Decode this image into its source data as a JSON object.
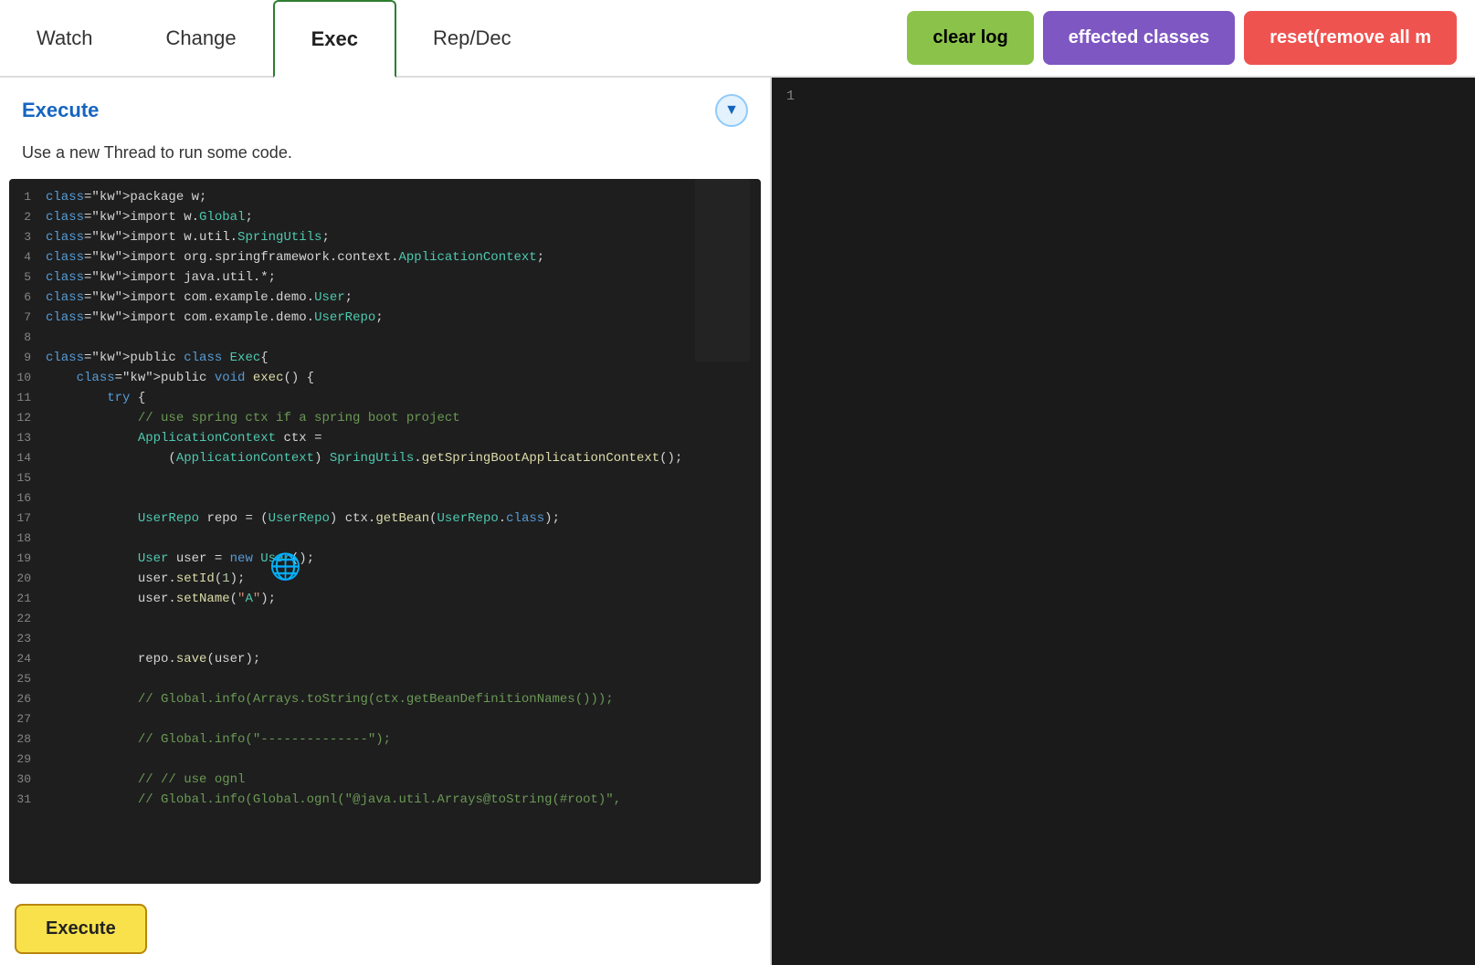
{
  "tabs": [
    {
      "id": "watch",
      "label": "Watch",
      "active": false
    },
    {
      "id": "change",
      "label": "Change",
      "active": false
    },
    {
      "id": "exec",
      "label": "Exec",
      "active": true
    },
    {
      "id": "rep-dec",
      "label": "Rep/Dec",
      "active": false
    }
  ],
  "buttons": {
    "clear_log": "clear log",
    "effected_classes": "effected classes",
    "reset": "reset(remove all m"
  },
  "execute_section": {
    "title": "Execute",
    "description": "Use a new Thread to run some code.",
    "dropdown_icon": "▼"
  },
  "execute_button": "Execute",
  "right_panel": {
    "line_number": "1"
  },
  "code": [
    {
      "n": 1,
      "raw": "package w;"
    },
    {
      "n": 2,
      "raw": "import w.Global;"
    },
    {
      "n": 3,
      "raw": "import w.util.SpringUtils;"
    },
    {
      "n": 4,
      "raw": "import org.springframework.context.ApplicationContext;"
    },
    {
      "n": 5,
      "raw": "import java.util.*;"
    },
    {
      "n": 6,
      "raw": "import com.example.demo.User;"
    },
    {
      "n": 7,
      "raw": "import com.example.demo.UserRepo;"
    },
    {
      "n": 8,
      "raw": ""
    },
    {
      "n": 9,
      "raw": "public class Exec{"
    },
    {
      "n": 10,
      "raw": "    public void exec() {"
    },
    {
      "n": 11,
      "raw": "        try {"
    },
    {
      "n": 12,
      "raw": "            // use spring ctx if a spring boot project"
    },
    {
      "n": 13,
      "raw": "            ApplicationContext ctx ="
    },
    {
      "n": 14,
      "raw": "                (ApplicationContext) SpringUtils.getSpringBootApplicationContext();"
    },
    {
      "n": 15,
      "raw": ""
    },
    {
      "n": 16,
      "raw": ""
    },
    {
      "n": 17,
      "raw": "            UserRepo repo = (UserRepo) ctx.getBean(UserRepo.class);"
    },
    {
      "n": 18,
      "raw": ""
    },
    {
      "n": 19,
      "raw": "            User user = new User();"
    },
    {
      "n": 20,
      "raw": "            user.setId(1);"
    },
    {
      "n": 21,
      "raw": "            user.setName(\"A\");"
    },
    {
      "n": 22,
      "raw": ""
    },
    {
      "n": 23,
      "raw": ""
    },
    {
      "n": 24,
      "raw": "            repo.save(user);"
    },
    {
      "n": 25,
      "raw": ""
    },
    {
      "n": 26,
      "raw": "            // Global.info(Arrays.toString(ctx.getBeanDefinitionNames()));"
    },
    {
      "n": 27,
      "raw": ""
    },
    {
      "n": 28,
      "raw": "            // Global.info(\"--------------\");"
    },
    {
      "n": 29,
      "raw": ""
    },
    {
      "n": 30,
      "raw": "            // // use ognl"
    },
    {
      "n": 31,
      "raw": "            // Global.info(Global.ognl(\"@java.util.Arrays@toString(#root)\","
    }
  ]
}
